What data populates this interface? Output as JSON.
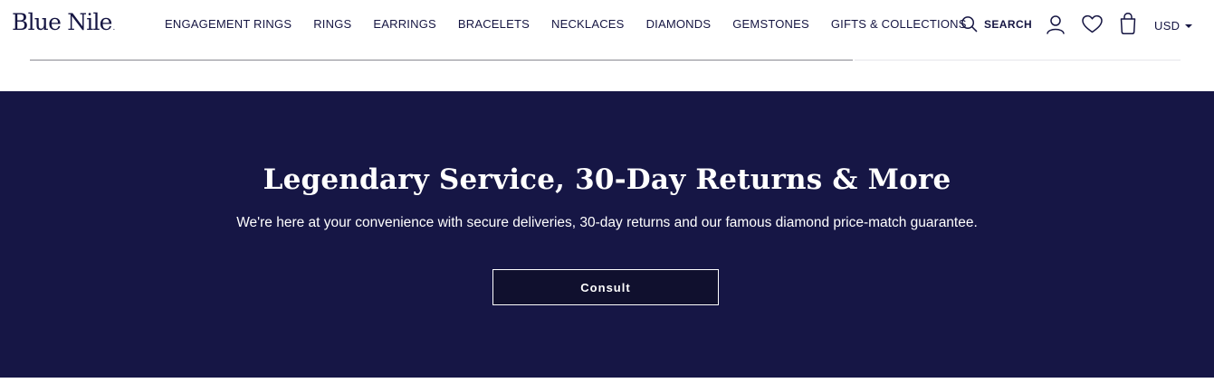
{
  "brand": {
    "logo_text": "Blue Nile",
    "logo_dot": "."
  },
  "nav": {
    "items": [
      {
        "label": "ENGAGEMENT RINGS"
      },
      {
        "label": "RINGS"
      },
      {
        "label": "EARRINGS"
      },
      {
        "label": "BRACELETS"
      },
      {
        "label": "NECKLACES"
      },
      {
        "label": "DIAMONDS"
      },
      {
        "label": "GEMSTONES"
      },
      {
        "label": "GIFTS & COLLECTIONS"
      }
    ]
  },
  "utilities": {
    "search_label": "SEARCH",
    "search_icon": "search-icon",
    "account_icon": "user-icon",
    "wishlist_icon": "heart-icon",
    "bag_icon": "shopping-bag-icon",
    "currency": "USD"
  },
  "banner": {
    "title": "Legendary Service, 30-Day Returns & More",
    "subtitle": "We're here at your convenience with secure deliveries, 30-day returns and our famous diamond price-match guarantee.",
    "cta_label": "Consult"
  },
  "colors": {
    "brand_navy": "#151542",
    "banner_bg": "#161645",
    "button_bg": "#10102e",
    "white": "#ffffff"
  }
}
